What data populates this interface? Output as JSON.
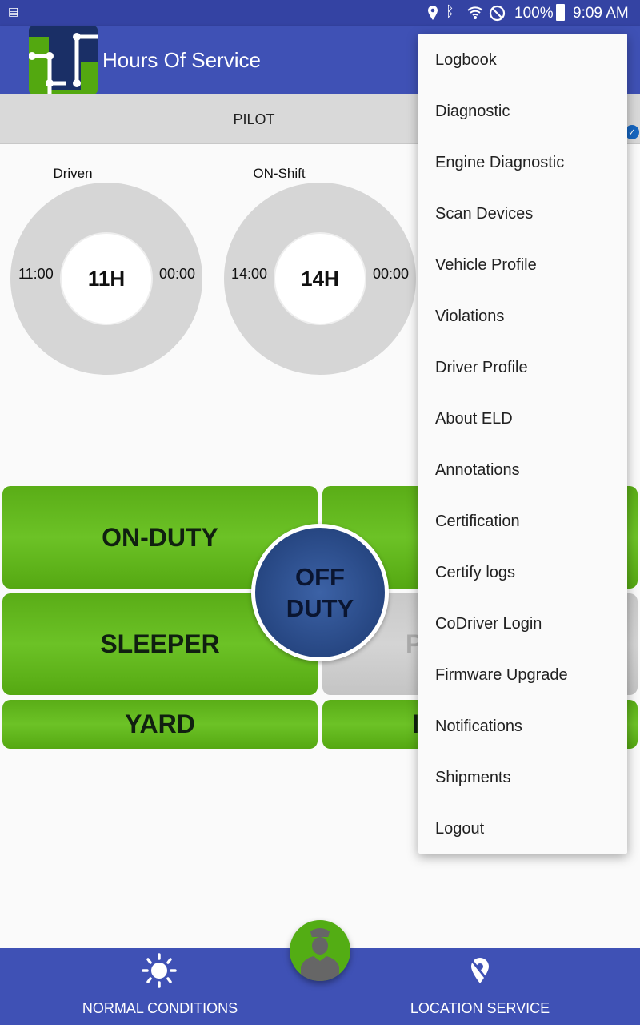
{
  "status_bar": {
    "battery": "100%",
    "time": "9:09 AM",
    "icons": [
      "sim-card-icon",
      "location-icon",
      "bluetooth-icon",
      "wifi-icon",
      "do-not-disturb-icon",
      "battery-icon"
    ]
  },
  "app_bar": {
    "title": "Hours Of Service"
  },
  "tabs": [
    {
      "label": "PILOT"
    }
  ],
  "gauges": [
    {
      "label": "Driven",
      "center": "11H",
      "left": "11:00",
      "right": "00:00"
    },
    {
      "label": "ON-Shift",
      "center": "14H",
      "left": "14:00",
      "right": "00:00"
    }
  ],
  "duty_buttons": {
    "on_duty": "ON-DUTY",
    "sleeper": "SLEEPER",
    "yard": "YARD",
    "off_duty_line1": "OFF",
    "off_duty_line2": "DUTY",
    "partial_gray": "P",
    "partial_bottom": "I"
  },
  "menu": {
    "items": [
      "Logbook",
      "Diagnostic",
      "Engine Diagnostic",
      "Scan Devices",
      "Vehicle Profile",
      "Violations",
      "Driver Profile",
      "About ELD",
      "Annotations",
      "Certification",
      "Certify logs",
      "CoDriver Login",
      "Firmware Upgrade",
      "Notifications",
      "Shipments",
      "Logout"
    ]
  },
  "bottom_nav": {
    "left": "NORMAL CONDITIONS",
    "right": "LOCATION SERVICE"
  },
  "colors": {
    "primary": "#3f51b5",
    "green": "#5cb21a",
    "off_duty": "#2a4a8c"
  }
}
